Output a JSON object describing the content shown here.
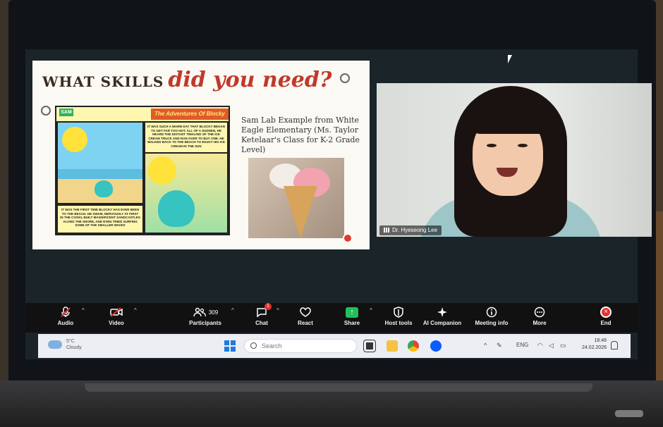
{
  "slide": {
    "title_part1": "WHAT SKILLS",
    "title_part2": "did you need?",
    "comic_title": "The Adventures Of Blocky",
    "comic_badge": "SAM",
    "caption_top": "IT WAS SUCH A WARM DAY THAT BLOCKY BEGAN TO GET FAR TOO HOT. ALL OF A SUDDEN, HE HEARD THE DISTANT TINKLING OF THE ICE CREAM TRUCK AND RAN OVER TO BUY ONE. HE WALKED BACK TO THE BEACH TO ENJOY HIS ICE CREAM IN THE SUN",
    "caption_bottom": "IT WAS THE FIRST TIME BLOCKY HAS EVER BEEN TO THE BEACH. HE SWAM, NERVOUSLY AT FIRST IN THE COOKL BUILT MAGNIFICENT SANDCASTLES ALONG THE SHORE, AND EVEN TRIED SURFING SOME OF THE SMALLER WAVES",
    "example_text": "Sam Lab Example from White Eagle Elementary (Ms. Taylor Ketelaar's Class for K-2 Grade Level)"
  },
  "video": {
    "participant_name": "Dr. Hyeseong Lee"
  },
  "toolbar": {
    "audio": "Audio",
    "video": "Video",
    "participants": "Participants",
    "participants_count": "309",
    "chat": "Chat",
    "chat_badge": "1",
    "react": "React",
    "share": "Share",
    "host_tools": "Host tools",
    "ai_companion": "AI Companion",
    "meeting_info": "Meeting info",
    "more": "More",
    "end": "End"
  },
  "taskbar": {
    "temperature": "5°C",
    "weather": "Cloudy",
    "search_placeholder": "Search",
    "language": "ENG",
    "time": "18:48",
    "date": "24.02.2026"
  },
  "colors": {
    "accent_red": "#c0392b",
    "share_green": "#21c05a",
    "end_red": "#e3312b"
  }
}
